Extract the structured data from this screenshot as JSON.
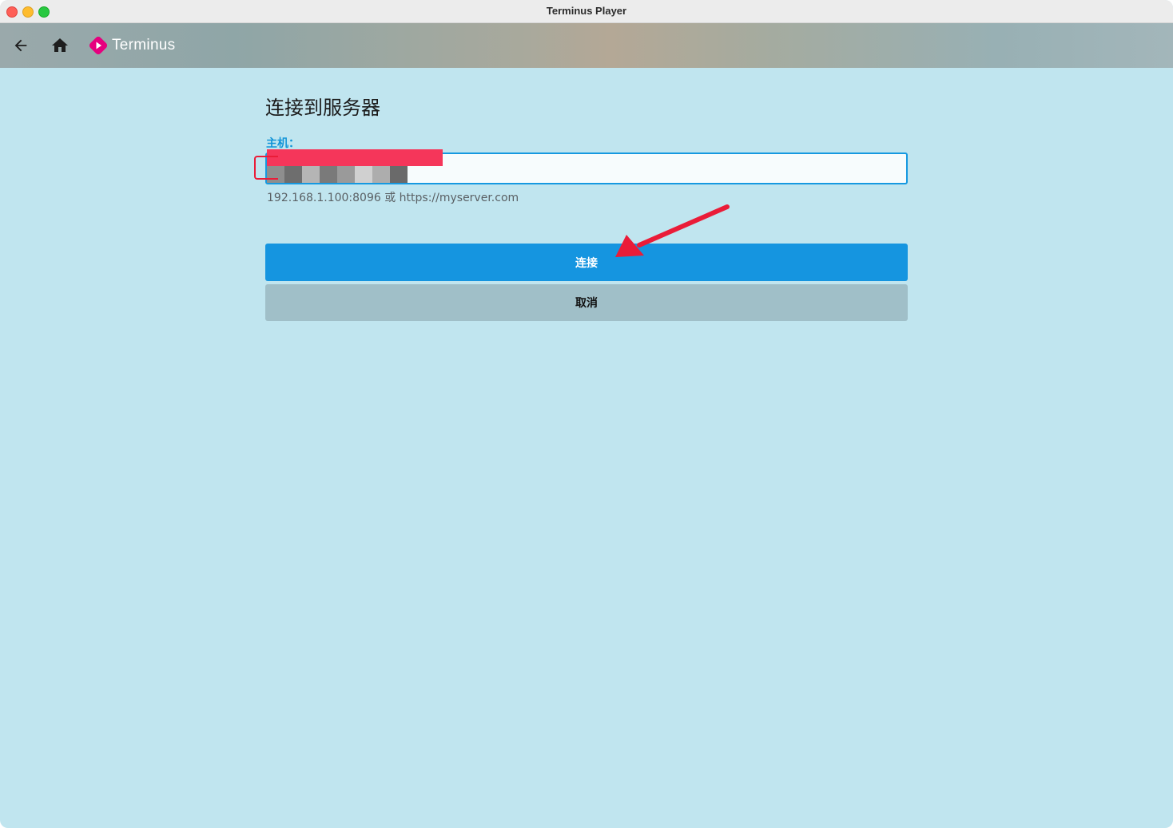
{
  "window": {
    "title": "Terminus Player"
  },
  "appbar": {
    "brand_name": "Terminus",
    "brand_color": "#e6007e",
    "icons": [
      "back-arrow-icon",
      "home-icon",
      "terminus-logo-icon"
    ]
  },
  "form": {
    "title": "连接到服务器",
    "host_label": "主机：",
    "host_value": "",
    "helper": "192.168.1.100:8096 或 https://myserver.com",
    "connect_label": "连接",
    "cancel_label": "取消"
  },
  "colors": {
    "background": "#c0e5ef",
    "accent": "#1595e0",
    "cancel_button": "#a0bfc8",
    "annotation": "#ea1c38"
  }
}
